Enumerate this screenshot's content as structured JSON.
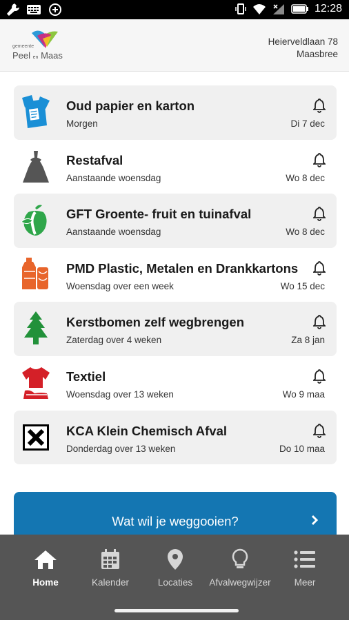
{
  "status_bar": {
    "time": "12:28"
  },
  "header": {
    "logo": {
      "small": "gemeente",
      "name_part1": "Peel",
      "name_en": "en",
      "name_part2": "Maas"
    },
    "address_line1": "Heierveldlaan 78",
    "address_line2": "Maasbree"
  },
  "pickups": [
    {
      "title": "Oud papier en karton",
      "when": "Morgen",
      "date": "Di 7 dec",
      "icon": "paper-recycling-icon",
      "color": "#1a8fd6"
    },
    {
      "title": "Restafval",
      "when": "Aanstaande woensdag",
      "date": "Wo 8 dec",
      "icon": "trash-bag-icon",
      "color": "#555555"
    },
    {
      "title": "GFT Groente- fruit en tuinafval",
      "when": "Aanstaande woensdag",
      "date": "Wo 8 dec",
      "icon": "organic-waste-icon",
      "color": "#2fa64a"
    },
    {
      "title": "PMD Plastic, Metalen en Drankkartons",
      "when": "Woensdag over een week",
      "date": "Wo 15 dec",
      "icon": "plastic-bottle-icon",
      "color": "#e8652b"
    },
    {
      "title": "Kerstbomen zelf wegbrengen",
      "when": "Zaterdag over 4 weken",
      "date": "Za 8 jan",
      "icon": "christmas-tree-icon",
      "color": "#22913a"
    },
    {
      "title": "Textiel",
      "when": "Woensdag over 13 weken",
      "date": "Wo 9 maa",
      "icon": "textile-icon",
      "color": "#d42028"
    },
    {
      "title": "KCA Klein Chemisch Afval",
      "when": "Donderdag over 13 weken",
      "date": "Do 10 maa",
      "icon": "hazardous-waste-icon",
      "color": "#000000"
    }
  ],
  "cta": {
    "label": "Wat wil je weggooien?"
  },
  "nav": [
    {
      "label": "Home",
      "icon": "home-icon",
      "active": true
    },
    {
      "label": "Kalender",
      "icon": "calendar-icon",
      "active": false
    },
    {
      "label": "Locaties",
      "icon": "location-pin-icon",
      "active": false
    },
    {
      "label": "Afvalwegwijzer",
      "icon": "lightbulb-icon",
      "active": false
    },
    {
      "label": "Meer",
      "icon": "menu-list-icon",
      "active": false
    }
  ],
  "colors": {
    "accent": "#1476b2",
    "nav_background": "#555555",
    "row_shade": "#f0f0f0"
  }
}
